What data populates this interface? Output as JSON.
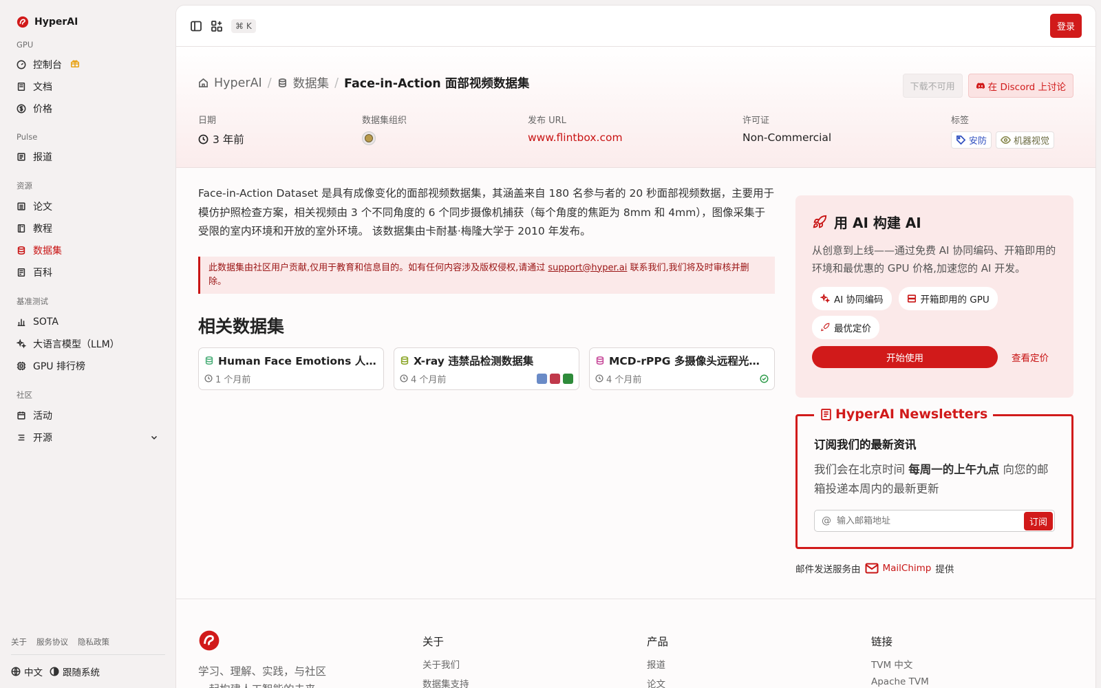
{
  "sidebar": {
    "brand": "HyperAI",
    "sections": {
      "gpu": "GPU",
      "pulse": "Pulse",
      "resources": "资源",
      "benchmark": "基准测试",
      "community": "社区"
    },
    "items": {
      "console": "控制台",
      "docs": "文档",
      "pricing": "价格",
      "news": "报道",
      "papers": "论文",
      "tutorials": "教程",
      "datasets": "数据集",
      "wiki": "百科",
      "sota": "SOTA",
      "llm": "大语言模型（LLM）",
      "gpu_rank": "GPU 排行榜",
      "events": "活动",
      "opensource": "开源"
    },
    "footer_links": [
      "关于",
      "服务协议",
      "隐私政策"
    ],
    "language": "中文",
    "theme": "跟随系统"
  },
  "topbar": {
    "shortcut": "⌘ K",
    "login": "登录"
  },
  "hero": {
    "breadcrumb": {
      "home": "HyperAI",
      "section": "数据集",
      "current": "Face-in-Action 面部视频数据集"
    },
    "download": "下载不可用",
    "discord": "在 Discord 上讨论",
    "meta": {
      "date_label": "日期",
      "date_value": "3 年前",
      "org_label": "数据集组织",
      "url_label": "发布 URL",
      "url_value": "www.flintbox.com",
      "license_label": "许可证",
      "license_value": "Non-Commercial",
      "tags_label": "标签",
      "tags": [
        "安防",
        "机器视觉"
      ]
    }
  },
  "content": {
    "description": "Face-in-Action Dataset 是具有成像变化的面部视频数据集，其涵盖来自 180 名参与者的 20 秒面部视频数据，主要用于模仿护照检查方案，相关视频由 3 个不同角度的 6 个同步摄像机捕获（每个角度的焦距为 8mm 和 4mm），图像采集于受限的室内环境和开放的室外环境。 该数据集由卡耐基·梅隆大学于 2010 年发布。",
    "notice_before": "此数据集由社区用户贡献,仅用于教育和信息目的。如有任何内容涉及版权侵权,请通过 ",
    "notice_email": "support@hyper.ai",
    "notice_after": " 联系我们,我们将及时审核并删除。",
    "related_title": "相关数据集",
    "related": [
      {
        "title": "Human Face Emotions 人…",
        "time": "1 个月前"
      },
      {
        "title": "X-ray 违禁品检测数据集",
        "time": "4 个月前"
      },
      {
        "title": "MCD-rPPG 多摄像头远程光…",
        "time": "4 个月前"
      }
    ]
  },
  "promo": {
    "title": "用 AI 构建 AI",
    "desc": "从创意到上线——通过免费 AI 协同编码、开箱即用的环境和最优惠的 GPU 价格,加速您的 AI 开发。",
    "chips": [
      "AI 协同编码",
      "开箱即用的 GPU",
      "最优定价"
    ],
    "start": "开始使用",
    "pricing": "查看定价"
  },
  "newsletter": {
    "legend": "HyperAI Newsletters",
    "title": "订阅我们的最新资讯",
    "desc_before": "我们会在北京时间 ",
    "desc_bold": "每周一的上午九点",
    "desc_after": " 向您的邮箱投递本周内的最新更新",
    "placeholder": "输入邮箱地址",
    "subscribe": "订阅",
    "provider_before": "邮件发送服务由",
    "provider": "MailChimp",
    "provider_after": "提供"
  },
  "footer": {
    "tagline": "学习、理解、实践，与社区一起构建人工智能的未来",
    "cols": [
      {
        "title": "关于",
        "links": [
          "关于我们",
          "数据集支持"
        ]
      },
      {
        "title": "产品",
        "links": [
          "报道",
          "论文"
        ]
      },
      {
        "title": "链接",
        "links": [
          "TVM 中文",
          "Apache TVM"
        ]
      }
    ]
  },
  "colors": {
    "accent": "#d11a1a",
    "sidebar_bg": "#f4f1f1"
  }
}
